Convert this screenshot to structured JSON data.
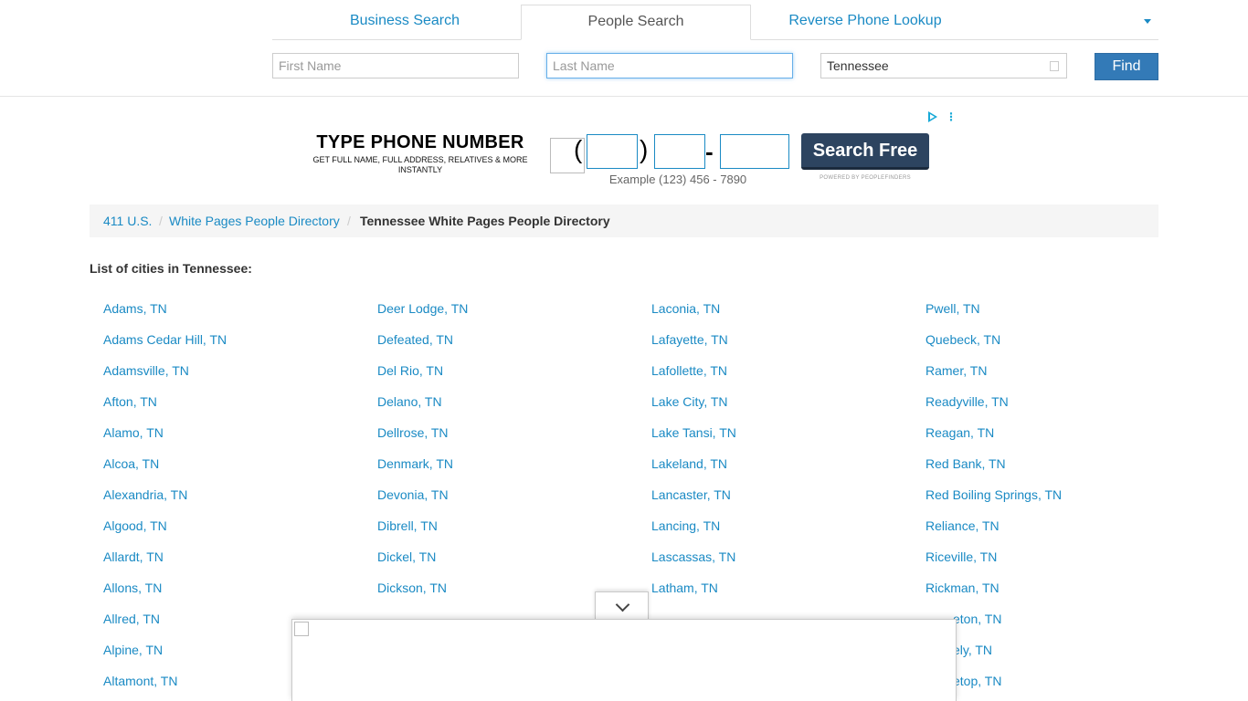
{
  "tabs": {
    "business": "Business Search",
    "people": "People Search",
    "reverse": "Reverse Phone Lookup"
  },
  "search": {
    "first_placeholder": "First Name",
    "last_placeholder": "Last Name",
    "state_value": "Tennessee",
    "find_label": "Find"
  },
  "ad": {
    "title": "TYPE PHONE NUMBER",
    "subtitle": "GET FULL NAME, FULL ADDRESS, RELATIVES & MORE INSTANTLY",
    "open_paren": "(",
    "close_paren": ")",
    "dash": "-",
    "example": "Example (123) 456 - 7890",
    "button": "Search Free",
    "powered_by": "POWERED BY PEOPLEFINDERS",
    "adchoices_dots": "⋮",
    "accent_color": "#17a9d7",
    "button_color": "#2d4460"
  },
  "breadcrumb": {
    "home": "411 U.S.",
    "directory": "White Pages People Directory",
    "separator": "/",
    "current": "Tennessee White Pages People Directory"
  },
  "list_heading": "List of cities in Tennessee:",
  "cities": {
    "col1": [
      "Adams, TN",
      "Adams Cedar Hill, TN",
      "Adamsville, TN",
      "Afton, TN",
      "Alamo, TN",
      "Alcoa, TN",
      "Alexandria, TN",
      "Algood, TN",
      "Allardt, TN",
      "Allons, TN",
      "Allred, TN",
      "Alpine, TN",
      "Altamont, TN"
    ],
    "col2": [
      "Deer Lodge, TN",
      "Defeated, TN",
      "Del Rio, TN",
      "Delano, TN",
      "Dellrose, TN",
      "Denmark, TN",
      "Devonia, TN",
      "Dibrell, TN",
      "Dickel, TN",
      "Dickson, TN"
    ],
    "col3": [
      "Laconia, TN",
      "Lafayette, TN",
      "Lafollette, TN",
      "Lake City, TN",
      "Lake Tansi, TN",
      "Lakeland, TN",
      "Lancaster, TN",
      "Lancing, TN",
      "Lascassas, TN",
      "Latham, TN"
    ],
    "col4": [
      "Pwell, TN",
      "Quebeck, TN",
      "Ramer, TN",
      "Readyville, TN",
      "Reagan, TN",
      "Red Bank, TN",
      "Red Boiling Springs, TN",
      "Reliance, TN",
      "Riceville, TN",
      "Rickman, TN",
      "eton, TN",
      "ely, TN",
      "etop, TN"
    ]
  },
  "colors": {
    "link": "#1a8ac4",
    "find_button": "#337ab7"
  }
}
